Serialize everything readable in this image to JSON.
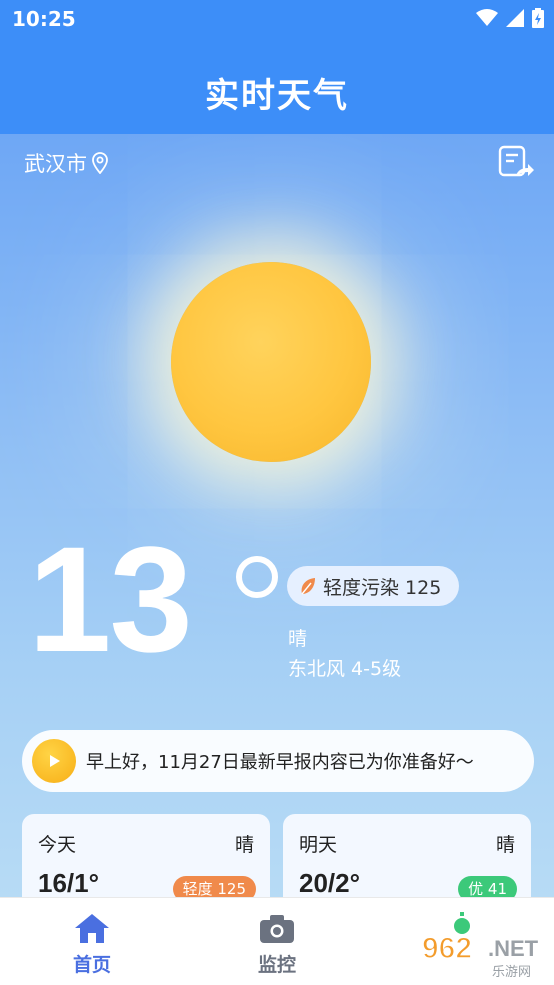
{
  "status_bar": {
    "time": "10:25"
  },
  "header": {
    "title": "实时天气"
  },
  "location": {
    "city": "武汉市"
  },
  "current": {
    "temperature": "13",
    "aqi_label": "轻度污染 125",
    "condition": "晴",
    "wind": "东北风 4-5级"
  },
  "news": {
    "text": "早上好，11月27日最新早报内容已为你准备好～"
  },
  "forecast": [
    {
      "day": "今天",
      "condition": "晴",
      "temp": "16/1°",
      "aqi": "轻度 125",
      "aqi_color": "#f08a4b"
    },
    {
      "day": "明天",
      "condition": "晴",
      "temp": "20/2°",
      "aqi": "优 41",
      "aqi_color": "#3cc97a"
    }
  ],
  "nav": {
    "items": [
      {
        "label": "首页",
        "icon": "home-icon"
      },
      {
        "label": "监控",
        "icon": "camera-icon"
      }
    ]
  },
  "watermark": {
    "text": "962.NET",
    "subtext": "乐游网"
  },
  "colors": {
    "header": "#3d8ef8",
    "nav_active": "#4a6fe0",
    "nav_inactive": "#6b7280"
  }
}
